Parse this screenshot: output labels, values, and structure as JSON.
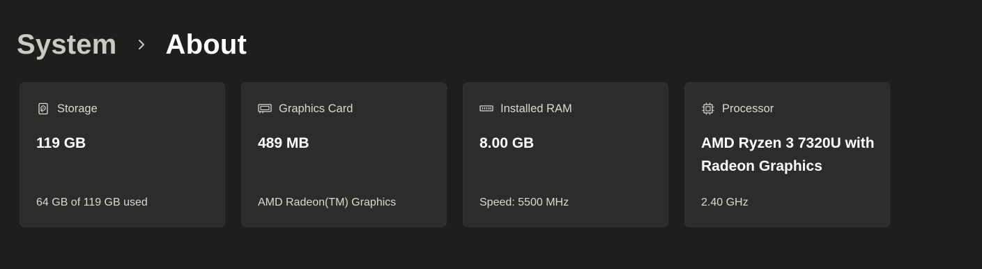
{
  "breadcrumb": {
    "parent": "System",
    "separator_icon": "chevron-right-icon",
    "current": "About"
  },
  "cards": [
    {
      "icon": "storage-drive-icon",
      "label": "Storage",
      "value": "119 GB",
      "sub": "64 GB of 119 GB used"
    },
    {
      "icon": "graphics-card-icon",
      "label": "Graphics Card",
      "value": "489 MB",
      "sub": "AMD Radeon(TM) Graphics"
    },
    {
      "icon": "ram-icon",
      "label": "Installed RAM",
      "value": "8.00 GB",
      "sub": "Speed: 5500 MHz"
    },
    {
      "icon": "processor-chip-icon",
      "label": "Processor",
      "value": "AMD Ryzen 3 7320U with Radeon Graphics",
      "sub": "2.40 GHz"
    }
  ],
  "colors": {
    "background": "#1c1f1b",
    "card_background": "#2a2d29",
    "text_primary": "#ffffff",
    "text_secondary": "#d8dad6",
    "breadcrumb_parent": "#c8cac6"
  }
}
